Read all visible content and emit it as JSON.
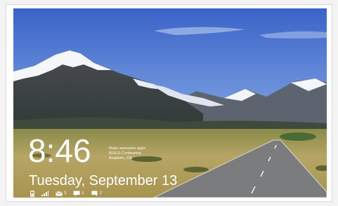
{
  "lock_screen": {
    "time": "8:46",
    "date": "Tuesday, September 13",
    "event": {
      "line1": "Make awesome apps",
      "line2": "BUILD Conference",
      "line3": "Anaheim, CA"
    },
    "notifications": [
      {
        "icon": "battery-icon",
        "count": ""
      },
      {
        "icon": "signal-icon",
        "count": ""
      },
      {
        "icon": "mail-icon",
        "count": "3"
      },
      {
        "icon": "message-icon",
        "count": "1"
      },
      {
        "icon": "chat-icon",
        "count": "2"
      }
    ]
  },
  "colors": {
    "sky_top": "#3a63c8",
    "sky_bottom": "#7ea3e2",
    "road": "#7b7b7b",
    "grass": "#b9a86a"
  }
}
